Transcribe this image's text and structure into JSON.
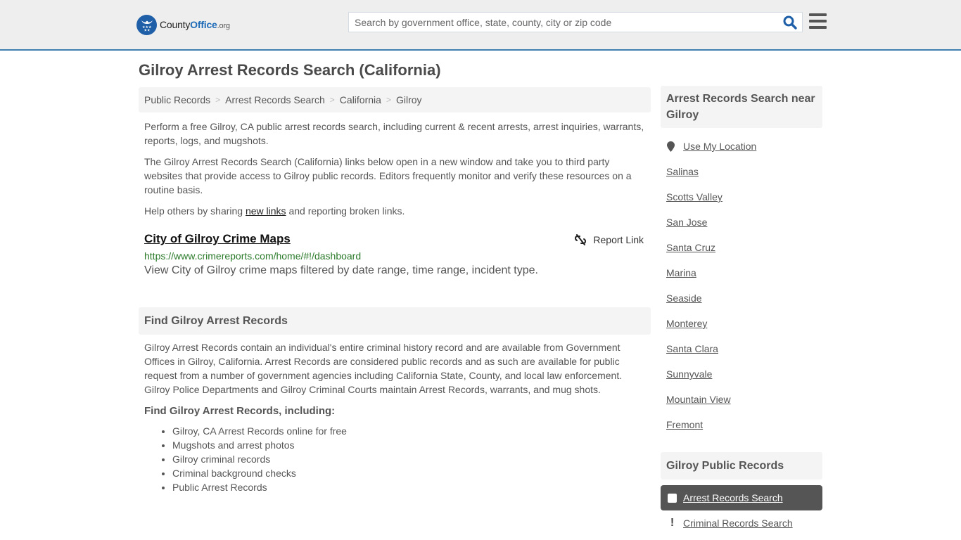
{
  "header": {
    "logo": {
      "name_part1": "County",
      "name_part2": "Office",
      "tld": ".org"
    },
    "search": {
      "placeholder": "Search by government office, state, county, city or zip code",
      "value": ""
    },
    "colors": {
      "brand_blue": "#1e5fa8",
      "header_bg": "#eeeeee",
      "header_border": "#3f7fb0"
    }
  },
  "page": {
    "title": "Gilroy Arrest Records Search (California)"
  },
  "breadcrumb": [
    {
      "label": "Public Records"
    },
    {
      "label": "Arrest Records Search"
    },
    {
      "label": "California"
    },
    {
      "label": "Gilroy"
    }
  ],
  "intro": {
    "p1": "Perform a free Gilroy, CA public arrest records search, including current & recent arrests, arrest inquiries, warrants, reports, logs, and mugshots.",
    "p2": "The Gilroy Arrest Records Search (California) links below open in a new window and take you to third party websites that provide access to Gilroy public records. Editors frequently monitor and verify these resources on a routine basis.",
    "p3_before": "Help others by sharing ",
    "p3_link": "new links",
    "p3_after": " and reporting broken links."
  },
  "resource": {
    "title": "City of Gilroy Crime Maps",
    "url": "https://www.crimereports.com/home/#!/dashboard",
    "description": "View City of Gilroy crime maps filtered by date range, time range, incident type.",
    "report_label": "Report Link"
  },
  "find_section": {
    "heading": "Find Gilroy Arrest Records",
    "body": "Gilroy Arrest Records contain an individual's entire criminal history record and are available from Government Offices in Gilroy, California. Arrest Records are considered public records and as such are available for public request from a number of government agencies including California State, County, and local law enforcement. Gilroy Police Departments and Gilroy Criminal Courts maintain Arrest Records, warrants, and mug shots.",
    "subheading": "Find Gilroy Arrest Records, including:",
    "bullets": [
      "Gilroy, CA Arrest Records online for free",
      "Mugshots and arrest photos",
      "Gilroy criminal records",
      "Criminal background checks",
      "Public Arrest Records"
    ]
  },
  "sidebar": {
    "nearby_heading": "Arrest Records Search near Gilroy",
    "use_location": "Use My Location",
    "cities": [
      "Salinas",
      "Scotts Valley",
      "San Jose",
      "Santa Cruz",
      "Marina",
      "Seaside",
      "Monterey",
      "Santa Clara",
      "Sunnyvale",
      "Mountain View",
      "Fremont"
    ],
    "public_records_heading": "Gilroy Public Records",
    "active_item": "Arrest Records Search",
    "next_item": "Criminal Records Search"
  }
}
